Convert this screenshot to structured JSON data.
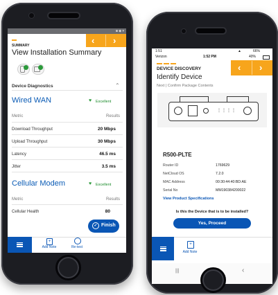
{
  "left_phone": {
    "screen": {
      "header": {
        "section": "SUMMARY",
        "title": "View Installation Summary"
      },
      "diagnostics_header": "Device Diagnostics",
      "wired_wan": {
        "title": "Wired WAN",
        "status": "Excellent",
        "col_metric": "Metric",
        "col_results": "Results",
        "rows": [
          {
            "metric": "Download Throughput",
            "result": "20 Mbps"
          },
          {
            "metric": "Upload Throughput",
            "result": "30 Mbps"
          },
          {
            "metric": "Latency",
            "result": "46.5 ms"
          },
          {
            "metric": "Jitter",
            "result": "3.5 ms"
          }
        ]
      },
      "cellular": {
        "title": "Cellular Modem",
        "status": "Excellent",
        "col_metric": "Metric",
        "col_results": "Results",
        "rows": [
          {
            "metric": "Cellular Health",
            "result": "80"
          }
        ]
      },
      "finish_button": "Finish",
      "toolbar": {
        "add_note": "Add Note",
        "retest": "Re-test"
      }
    }
  },
  "right_phone": {
    "status_bar": {
      "time": "1:51",
      "carrier": "Verizon",
      "clock": "1:52 PM",
      "battery_right": "66%",
      "battery_left": "40%"
    },
    "screen": {
      "header": {
        "section": "DEVICE DISCOVERY",
        "title": "Identify Device",
        "subtitle": "Next | Confirm Package Contents"
      },
      "device_model": "R500-PLTE",
      "specs": [
        {
          "label": "Router ID",
          "value": "1769629"
        },
        {
          "label": "NetCloud OS",
          "value": "7.2.0"
        },
        {
          "label": "MAC Address",
          "value": "00:30:44:40:BD:AE"
        },
        {
          "label": "Serial No",
          "value": "MM190384200022"
        }
      ],
      "spec_link": "View Product Specifications",
      "question": "Is this the Device that is to be installed?",
      "proceed_button": "Yes, Proceed",
      "toolbar": {
        "add_note": "Add Note"
      }
    }
  },
  "colors": {
    "brand_blue": "#0a56b5",
    "accent_orange": "#f7a51c",
    "excellent_green": "#1a8a2a"
  }
}
